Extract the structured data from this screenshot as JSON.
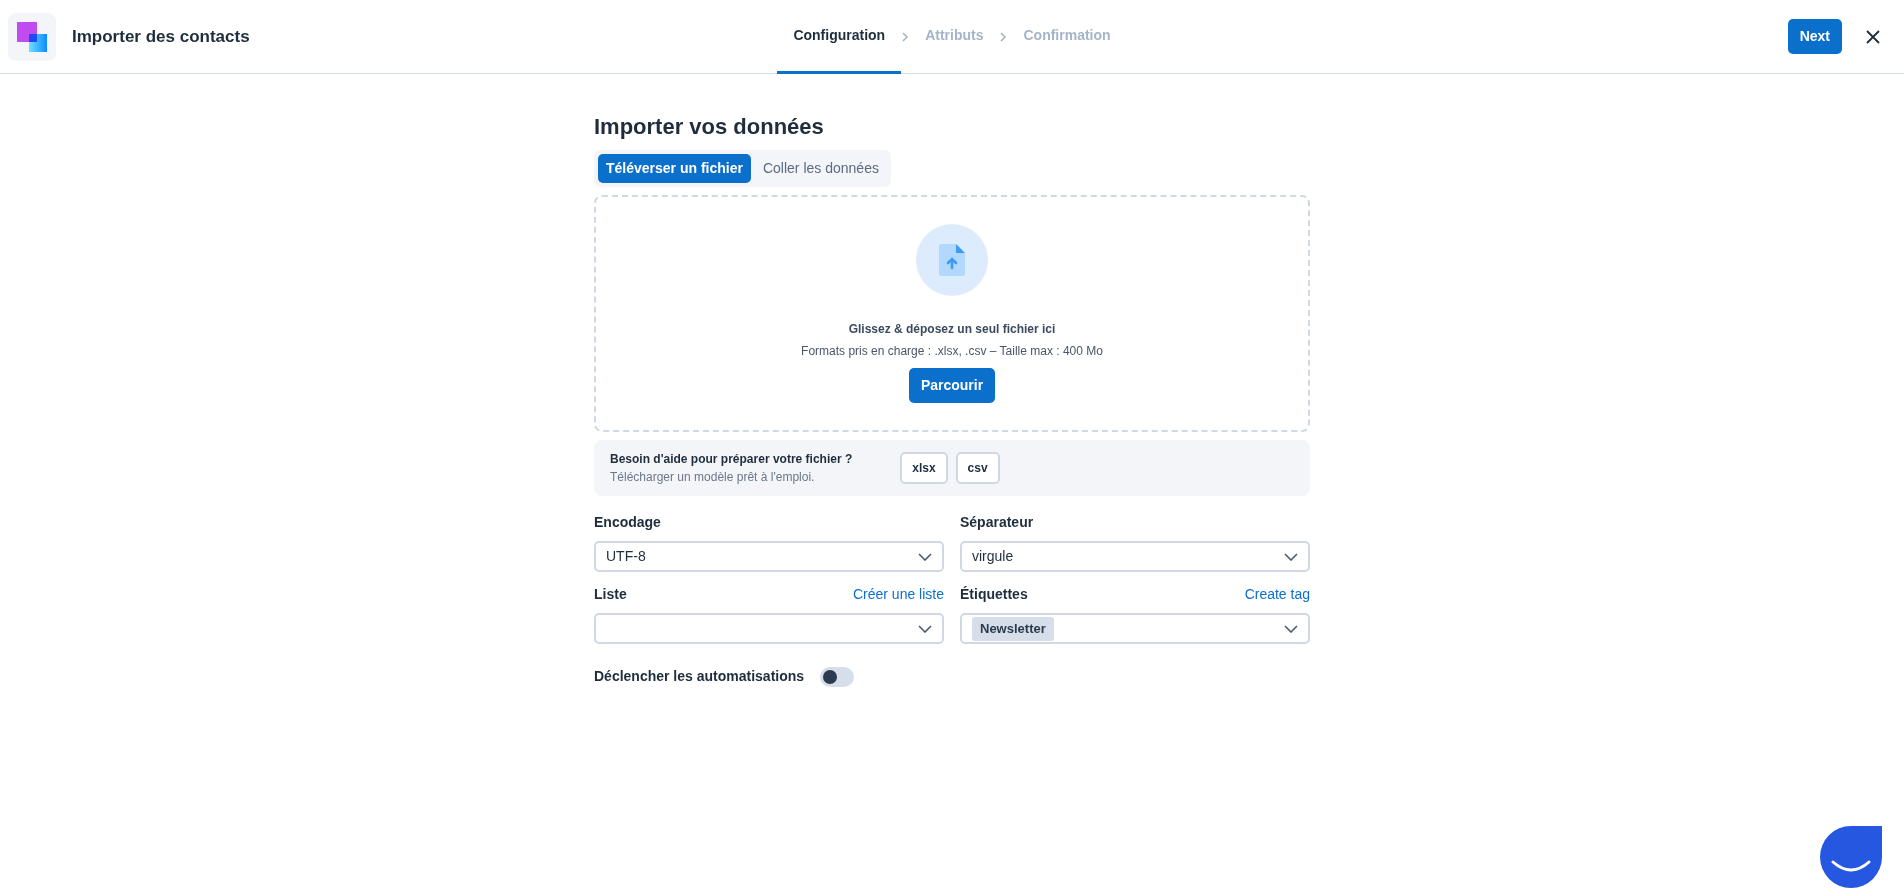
{
  "header": {
    "title": "Importer des contacts",
    "steps": [
      {
        "label": "Configuration",
        "selected": true
      },
      {
        "label": "Attributs",
        "selected": false
      },
      {
        "label": "Confirmation",
        "selected": false
      }
    ],
    "next_button": "Next"
  },
  "import": {
    "heading": "Importer vos données",
    "tabs": [
      {
        "label": "Téléverser un fichier",
        "selected": true
      },
      {
        "label": "Coller les données",
        "selected": false
      }
    ],
    "dropzone": {
      "title": "Glissez & déposez un seul fichier ici",
      "hint": "Formats pris en charge : .xlsx, .csv – Taille max : 400 Mo",
      "button": "Parcourir"
    },
    "help": {
      "title": "Besoin d'aide pour préparer votre fichier ?",
      "subtitle": "Télécharger un modèle prêt à l'emploi.",
      "templates": [
        "xlsx",
        "csv"
      ]
    }
  },
  "fields": [
    {
      "label": "Encodage",
      "value": "UTF-8"
    },
    {
      "label": "Séparateur",
      "value": "virgule"
    },
    {
      "label": "Liste",
      "link": "Créer une liste"
    },
    {
      "label": "Étiquettes",
      "link": "Create tag",
      "tags": [
        "Newsletter"
      ]
    }
  ],
  "automation_toggle": {
    "label": "Déclencher les automatisations",
    "on": false
  }
}
